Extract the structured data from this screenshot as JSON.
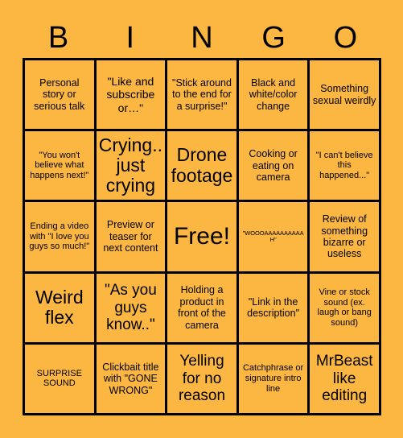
{
  "background_color": "#fcb743",
  "text_color": "#000000",
  "border_color": "#000000",
  "header": {
    "letters": [
      "B",
      "I",
      "N",
      "G",
      "O"
    ]
  },
  "grid": {
    "columns": 5,
    "rows": 5,
    "cells": [
      {
        "text": "Personal story or serious talk",
        "size": "sm"
      },
      {
        "text": "\"Like and subscribe or…\"",
        "size": "md"
      },
      {
        "text": "\"Stick around to the end for a surprise!\"",
        "size": "sm"
      },
      {
        "text": "Black and white/color change",
        "size": "sm"
      },
      {
        "text": "Something sexual weirdly",
        "size": "sm"
      },
      {
        "text": "\"You won't believe what happens next!\"",
        "size": "xs"
      },
      {
        "text": "Crying.. just crying",
        "size": "xl"
      },
      {
        "text": "Drone footage",
        "size": "xl"
      },
      {
        "text": "Cooking or eating on camera",
        "size": "sm"
      },
      {
        "text": "\"I can't believe this happened...\"",
        "size": "xs"
      },
      {
        "text": "Ending a video with \"I love you guys so much!\"",
        "size": "xs"
      },
      {
        "text": "Preview or teaser for next content",
        "size": "sm"
      },
      {
        "text": "Free!",
        "size": "xxl"
      },
      {
        "text": "\"WOOOAAAAAAAAAAH\"",
        "size": "xxs"
      },
      {
        "text": "Review of something bizarre or useless",
        "size": "sm"
      },
      {
        "text": "Weird flex",
        "size": "xl"
      },
      {
        "text": "\"As you guys know..\"",
        "size": "lg"
      },
      {
        "text": "Holding a product in front of the camera",
        "size": "sm"
      },
      {
        "text": "\"Link in the description\"",
        "size": "sm"
      },
      {
        "text": "Vine or stock sound (ex. laugh or bang sound)",
        "size": "xs"
      },
      {
        "text": "SURPRISE SOUND",
        "size": "xs"
      },
      {
        "text": "Clickbait title with \"GONE WRONG\"",
        "size": "sm"
      },
      {
        "text": "Yelling for no reason",
        "size": "lg"
      },
      {
        "text": "Catchphrase or signature intro line",
        "size": "xs"
      },
      {
        "text": "MrBeast like editing",
        "size": "lg"
      }
    ]
  }
}
